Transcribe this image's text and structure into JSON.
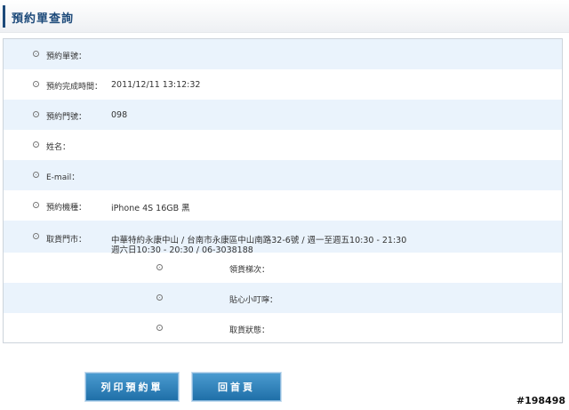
{
  "header": {
    "title": "預約單查詢"
  },
  "fields": [
    {
      "label": "預約單號：",
      "value": ""
    },
    {
      "label": "預約完成時間：",
      "value": "2011/12/11 13:12:32"
    },
    {
      "label": "預約門號：",
      "value": "098"
    },
    {
      "label": "姓名：",
      "value": ""
    },
    {
      "label": "E-mail：",
      "value": ""
    },
    {
      "label": "預約機種：",
      "value": "iPhone 4S 16GB 黑"
    },
    {
      "label": "取貨門市：",
      "value_line1": "中華特約永康中山 / 台南市永康區中山南路32-6號 / 週一至週五10:30 - 21:30",
      "value_line2": "週六日10:30 - 20:30 / 06-3038188"
    }
  ],
  "subfields": [
    {
      "label": "領貨梯次："
    },
    {
      "label": "貼心小叮嚀："
    },
    {
      "label": "取貨狀態："
    }
  ],
  "buttons": {
    "print": "列印預約單",
    "home": "回首頁"
  },
  "watermark": "#198498",
  "colors": {
    "title": "#1d4a7a",
    "row_alt": "#eaf3fc",
    "button": "#2a7db8"
  }
}
